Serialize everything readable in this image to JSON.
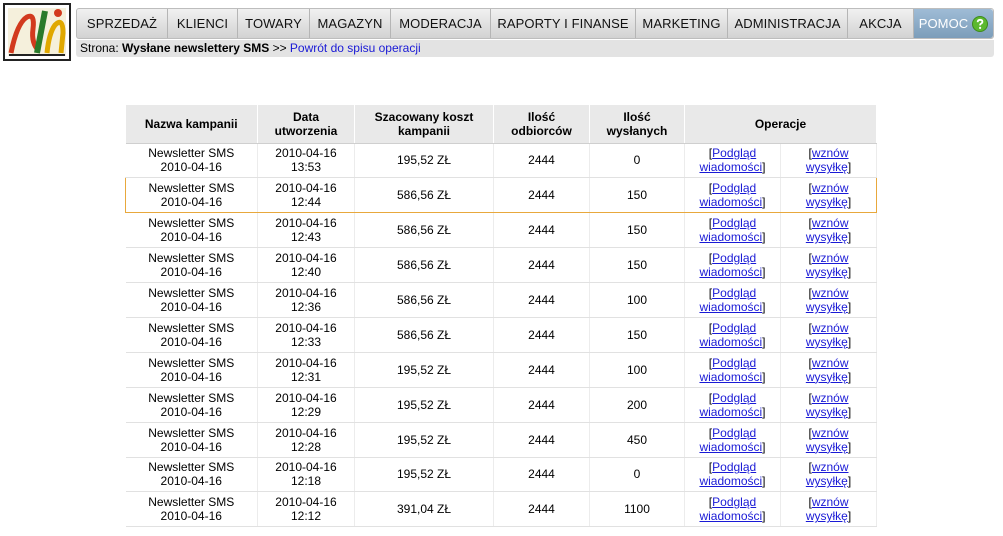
{
  "nav": {
    "items": [
      "SPRZEDAŻ",
      "KLIENCI",
      "TOWARY",
      "MAGAZYN",
      "MODERACJA",
      "RAPORTY I FINANSE",
      "MARKETING",
      "ADMINISTRACJA",
      "AKCJA"
    ],
    "help_label": "POMOC"
  },
  "crumb": {
    "prefix": "Strona:",
    "title": "Wysłane newslettery SMS",
    "separator": ">>",
    "back_link": "Powrót do spisu operacji"
  },
  "table": {
    "headers": {
      "name": "Nazwa kampanii",
      "date": "Data utworzenia",
      "cost": "Szacowany koszt kampanii",
      "recipients": "Ilość odbiorców",
      "sent": "Ilość wysłanych",
      "ops": "Operacje"
    },
    "op_preview": "Podgląd wiadomości",
    "op_resume": "wznów wysyłkę",
    "rows": [
      {
        "name": "Newsletter SMS 2010-04-16",
        "date": "2010-04-16 13:53",
        "cost": "195,52 ZŁ",
        "recipients": "2444",
        "sent": "0"
      },
      {
        "name": "Newsletter SMS 2010-04-16",
        "date": "2010-04-16 12:44",
        "cost": "586,56 ZŁ",
        "recipients": "2444",
        "sent": "150"
      },
      {
        "name": "Newsletter SMS 2010-04-16",
        "date": "2010-04-16 12:43",
        "cost": "586,56 ZŁ",
        "recipients": "2444",
        "sent": "150"
      },
      {
        "name": "Newsletter SMS 2010-04-16",
        "date": "2010-04-16 12:40",
        "cost": "586,56 ZŁ",
        "recipients": "2444",
        "sent": "150"
      },
      {
        "name": "Newsletter SMS 2010-04-16",
        "date": "2010-04-16 12:36",
        "cost": "586,56 ZŁ",
        "recipients": "2444",
        "sent": "100"
      },
      {
        "name": "Newsletter SMS 2010-04-16",
        "date": "2010-04-16 12:33",
        "cost": "586,56 ZŁ",
        "recipients": "2444",
        "sent": "150"
      },
      {
        "name": "Newsletter SMS 2010-04-16",
        "date": "2010-04-16 12:31",
        "cost": "195,52 ZŁ",
        "recipients": "2444",
        "sent": "100"
      },
      {
        "name": "Newsletter SMS 2010-04-16",
        "date": "2010-04-16 12:29",
        "cost": "195,52 ZŁ",
        "recipients": "2444",
        "sent": "200"
      },
      {
        "name": "Newsletter SMS 2010-04-16",
        "date": "2010-04-16 12:28",
        "cost": "195,52 ZŁ",
        "recipients": "2444",
        "sent": "450"
      },
      {
        "name": "Newsletter SMS 2010-04-16",
        "date": "2010-04-16 12:18",
        "cost": "195,52 ZŁ",
        "recipients": "2444",
        "sent": "0"
      },
      {
        "name": "Newsletter SMS 2010-04-16",
        "date": "2010-04-16 12:12",
        "cost": "391,04 ZŁ",
        "recipients": "2444",
        "sent": "1100"
      }
    ],
    "highlighted_row": 1
  },
  "colors": {
    "link": "#1a1ad6",
    "highlight_border": "#e8a83c",
    "help_tab": "#8aa9c6"
  }
}
